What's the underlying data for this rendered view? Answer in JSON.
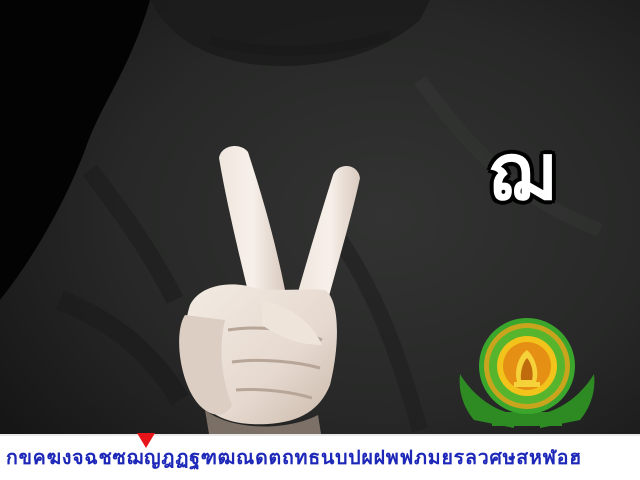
{
  "caption": {
    "letter": "ฌ"
  },
  "alphabet_bar": {
    "letters": "กขคฆงจฉชซฌญฎฏฐฑฒณดตถทธนบปผฝพฟภมยรลวศษสหฬอฮ",
    "marker_color": "#e8141a",
    "text_color": "#1d27b8"
  },
  "emblem": {
    "icon": "university-seal-icon",
    "ring_color": "#3aa62c",
    "ribbon_color": "#2e8b23"
  },
  "scene": {
    "background_color": "#030303",
    "shirt_color": "#262726",
    "hand_color": "#e7dcd3",
    "gesture": "two-finger-v-handshape"
  }
}
